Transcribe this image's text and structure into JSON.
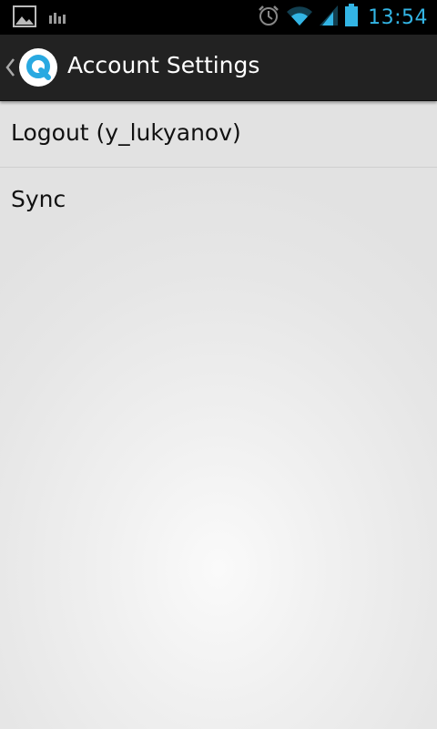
{
  "status_bar": {
    "time": "13:54",
    "icons": [
      "gallery-notification-icon",
      "bar-chart-notification-icon",
      "alarm-icon",
      "wifi-icon",
      "cell-signal-icon",
      "battery-icon"
    ],
    "accent_color": "#33b5e5"
  },
  "action_bar": {
    "title": "Account Settings",
    "logo_letter": "Q",
    "logo_color": "#29a9e1"
  },
  "menu": {
    "items": [
      {
        "label": "Logout (y_lukyanov)"
      },
      {
        "label": "Sync"
      }
    ]
  }
}
